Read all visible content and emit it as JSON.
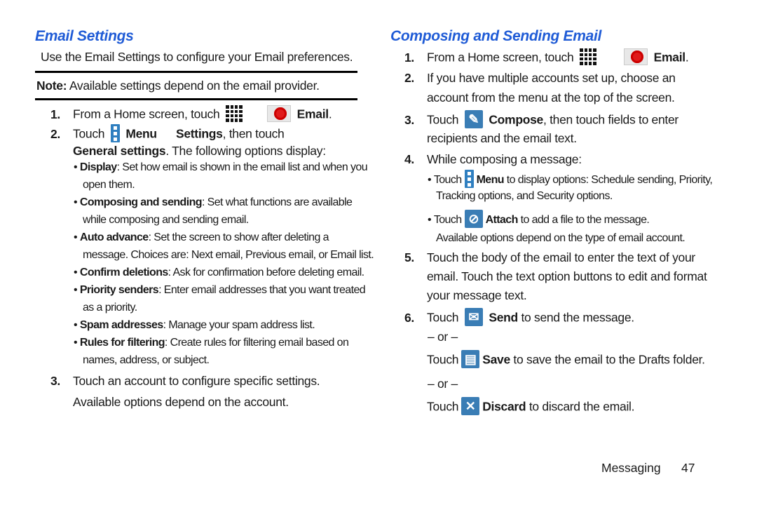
{
  "left": {
    "title": "Email Settings",
    "intro": "Use the Email Settings to configure your Email preferences.",
    "note_label": "Note:",
    "note_text": " Available settings depend on the email provider.",
    "steps": [
      {
        "num": "1.",
        "pre": "From a Home screen, touch",
        "icon1": "apps-grid-icon",
        "icon2": "email-app-icon",
        "bold": "Email",
        "post": "."
      },
      {
        "num": "2.",
        "pre": "Touch",
        "icon": "menu-icon",
        "bold1": "Menu",
        "bold2": "Settings",
        "mid": ", then touch",
        "line2_bold": "General settings",
        "line2_post": ". The following options display:"
      }
    ],
    "bullets": [
      {
        "label": "Display",
        "lines": [
          ": Set how email is shown in the email list and when you",
          "open them."
        ]
      },
      {
        "label": "Composing and sending",
        "lines": [
          ": Set what functions are available",
          "while composing and sending email."
        ]
      },
      {
        "label": "Auto advance",
        "lines": [
          ": Set the screen to show after deleting a",
          "message. Choices are: Next email, Previous email, or Email list."
        ]
      },
      {
        "label": "Confirm deletions",
        "lines": [
          ": Ask for confirmation before deleting email."
        ]
      },
      {
        "label": "Priority senders",
        "lines": [
          ": Enter email addresses that you want treated",
          "as a priority."
        ]
      },
      {
        "label": "Spam addresses",
        "lines": [
          ": Manage your spam address list."
        ]
      },
      {
        "label": "Rules for filtering",
        "lines": [
          ": Create rules for filtering email based on",
          "names, address, or subject."
        ]
      }
    ],
    "step3": {
      "num": "3.",
      "line1": "Touch an account to configure specific settings.",
      "line2": "Available options depend on the account."
    }
  },
  "right": {
    "title": "Composing and Sending Email",
    "step1": {
      "num": "1.",
      "pre": "From a Home screen, touch",
      "bold": "Email",
      "post": "."
    },
    "step2": {
      "num": "2.",
      "line1": "If you have multiple accounts set up, choose an",
      "line2": "account from the menu at the top of the screen."
    },
    "step3": {
      "num": "3.",
      "pre": "Touch",
      "bold": "Compose",
      "post": ", then touch fields to enter",
      "line2": "recipients and the email text."
    },
    "step4": {
      "num": "4.",
      "text": "While composing a message:"
    },
    "bullet1": {
      "pre": "Touch",
      "bold": "Menu",
      "post": " to display options: Schedule sending, Priority,",
      "line2": "Tracking options, and Security options."
    },
    "bullet2": {
      "pre": "Touch",
      "bold": "Attach",
      "post": " to add a file to the message."
    },
    "note": "Available options depend on the type of email account.",
    "step5": {
      "num": "5.",
      "line1": "Touch the body of the email to enter the text of your",
      "line2": "email. Touch the text option buttons to edit and format",
      "line3": "your message text."
    },
    "step6": {
      "num": "6.",
      "pre": "Touch",
      "bold": "Send",
      "post": " to send the message."
    },
    "or1": "– or –",
    "save": {
      "pre": "Touch",
      "bold": "Save",
      "post": " to save the email to the Drafts folder."
    },
    "or2": "– or –",
    "discard": {
      "pre": "Touch",
      "bold": "Discard",
      "post": " to discard the email."
    }
  },
  "footer": {
    "section": "Messaging",
    "page": "47"
  }
}
